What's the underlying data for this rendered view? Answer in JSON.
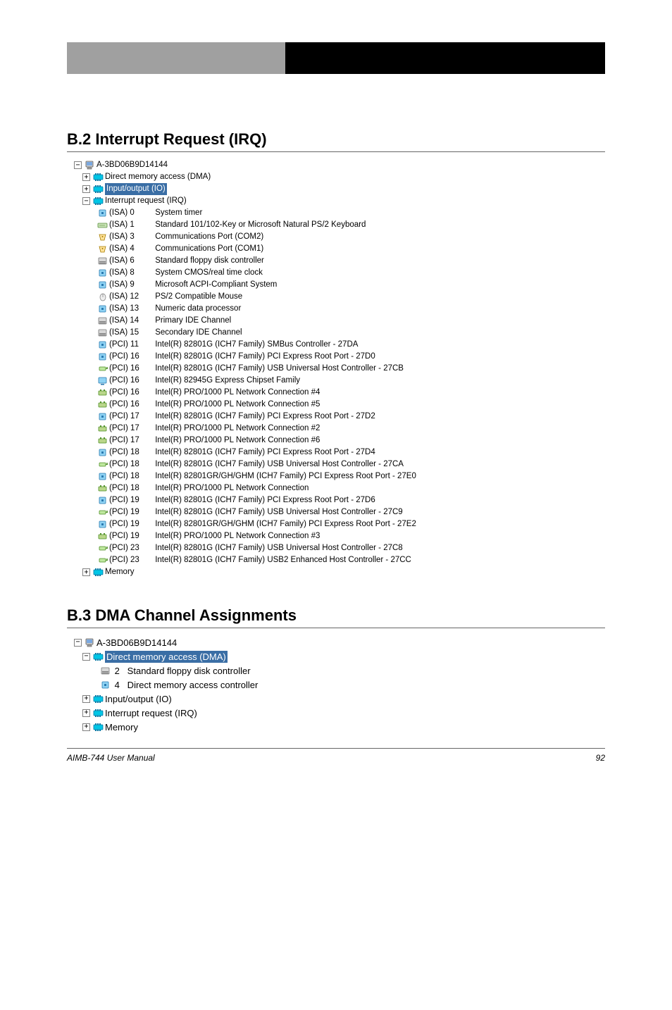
{
  "header": {
    "right": "                         "
  },
  "section1": {
    "title": "B.2 Interrupt Request (IRQ)",
    "root": "A-3BD06B9D14144",
    "node_dma": "Direct memory access (DMA)",
    "node_io": "Input/output (IO)",
    "node_irq": "Interrupt request (IRQ)",
    "items": [
      {
        "bus": "(ISA)  0",
        "name": "System timer",
        "icon": "chip"
      },
      {
        "bus": "(ISA)  1",
        "name": "Standard 101/102-Key or Microsoft Natural PS/2 Keyboard",
        "icon": "keyboard"
      },
      {
        "bus": "(ISA)  3",
        "name": "Communications Port (COM2)",
        "icon": "port"
      },
      {
        "bus": "(ISA)  4",
        "name": "Communications Port (COM1)",
        "icon": "port"
      },
      {
        "bus": "(ISA)  6",
        "name": "Standard floppy disk controller",
        "icon": "floppy"
      },
      {
        "bus": "(ISA)  8",
        "name": "System CMOS/real time clock",
        "icon": "chip"
      },
      {
        "bus": "(ISA)  9",
        "name": "Microsoft ACPI-Compliant System",
        "icon": "chip"
      },
      {
        "bus": "(ISA) 12",
        "name": "PS/2 Compatible Mouse",
        "icon": "mouse"
      },
      {
        "bus": "(ISA) 13",
        "name": "Numeric data processor",
        "icon": "chip"
      },
      {
        "bus": "(ISA) 14",
        "name": "Primary IDE Channel",
        "icon": "floppy"
      },
      {
        "bus": "(ISA) 15",
        "name": "Secondary IDE Channel",
        "icon": "floppy"
      },
      {
        "bus": "(PCI) 11",
        "name": "Intel(R) 82801G (ICH7 Family) SMBus Controller - 27DA",
        "icon": "chip"
      },
      {
        "bus": "(PCI) 16",
        "name": "Intel(R) 82801G (ICH7 Family) PCI Express Root Port - 27D0",
        "icon": "chip"
      },
      {
        "bus": "(PCI) 16",
        "name": "Intel(R) 82801G (ICH7 Family) USB Universal Host Controller - 27CB",
        "icon": "usb"
      },
      {
        "bus": "(PCI) 16",
        "name": "Intel(R) 82945G Express Chipset Family",
        "icon": "monitor"
      },
      {
        "bus": "(PCI) 16",
        "name": "Intel(R) PRO/1000 PL Network Connection #4",
        "icon": "net"
      },
      {
        "bus": "(PCI) 16",
        "name": "Intel(R) PRO/1000 PL Network Connection #5",
        "icon": "net"
      },
      {
        "bus": "(PCI) 17",
        "name": "Intel(R) 82801G (ICH7 Family) PCI Express Root Port - 27D2",
        "icon": "chip"
      },
      {
        "bus": "(PCI) 17",
        "name": "Intel(R) PRO/1000 PL Network Connection #2",
        "icon": "net"
      },
      {
        "bus": "(PCI) 17",
        "name": "Intel(R) PRO/1000 PL Network Connection #6",
        "icon": "net"
      },
      {
        "bus": "(PCI) 18",
        "name": "Intel(R) 82801G (ICH7 Family) PCI Express Root Port - 27D4",
        "icon": "chip"
      },
      {
        "bus": "(PCI) 18",
        "name": "Intel(R) 82801G (ICH7 Family) USB Universal Host Controller - 27CA",
        "icon": "usb"
      },
      {
        "bus": "(PCI) 18",
        "name": "Intel(R) 82801GR/GH/GHM (ICH7 Family) PCI Express Root Port - 27E0",
        "icon": "chip"
      },
      {
        "bus": "(PCI) 18",
        "name": "Intel(R) PRO/1000 PL Network Connection",
        "icon": "net"
      },
      {
        "bus": "(PCI) 19",
        "name": "Intel(R) 82801G (ICH7 Family) PCI Express Root Port - 27D6",
        "icon": "chip"
      },
      {
        "bus": "(PCI) 19",
        "name": "Intel(R) 82801G (ICH7 Family) USB Universal Host Controller - 27C9",
        "icon": "usb"
      },
      {
        "bus": "(PCI) 19",
        "name": "Intel(R) 82801GR/GH/GHM (ICH7 Family) PCI Express Root Port - 27E2",
        "icon": "chip"
      },
      {
        "bus": "(PCI) 19",
        "name": "Intel(R) PRO/1000 PL Network Connection #3",
        "icon": "net"
      },
      {
        "bus": "(PCI) 23",
        "name": "Intel(R) 82801G (ICH7 Family) USB Universal Host Controller - 27C8",
        "icon": "usb"
      },
      {
        "bus": "(PCI) 23",
        "name": "Intel(R) 82801G (ICH7 Family) USB2 Enhanced Host Controller - 27CC",
        "icon": "usb"
      }
    ],
    "node_memory": "Memory"
  },
  "section2": {
    "title": "B.3 DMA Channel Assignments",
    "root": "A-3BD06B9D14144",
    "node_dma": "Direct memory access (DMA)",
    "items": [
      {
        "num": "2",
        "name": "Standard floppy disk controller",
        "icon": "floppy"
      },
      {
        "num": "4",
        "name": "Direct memory access controller",
        "icon": "chip"
      }
    ],
    "node_io": "Input/output (IO)",
    "node_irq": "Interrupt request (IRQ)",
    "node_memory": "Memory"
  },
  "footer": {
    "left": "AIMB-744 User Manual",
    "right": "92"
  }
}
